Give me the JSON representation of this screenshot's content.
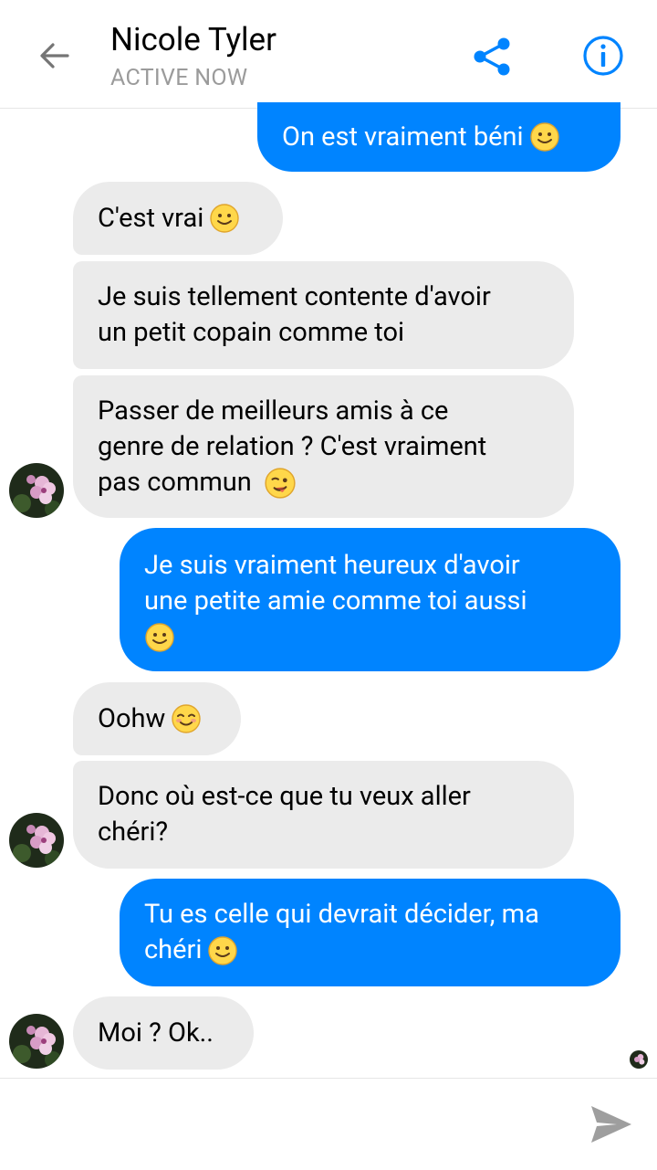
{
  "header": {
    "contact_name": "Nicole Tyler",
    "status": "ACTIVE NOW",
    "back_icon": "arrow-left-icon",
    "share_icon": "share-icon",
    "info_icon": "info-icon"
  },
  "messages": [
    {
      "dir": "out",
      "text": "On est vraiment béni",
      "emoji": "smile"
    },
    {
      "dir": "in",
      "text": "C'est vrai",
      "emoji": "smile"
    },
    {
      "dir": "in",
      "text_lines": [
        "Je suis tellement contente d'avoir",
        "un petit copain comme toi"
      ]
    },
    {
      "dir": "in",
      "text_lines": [
        "Passer de meilleurs amis à ce",
        "genre de relation ? C'est vraiment",
        "pas commun"
      ],
      "emoji": "wink"
    },
    {
      "dir": "out",
      "text_lines": [
        "Je suis vraiment heureux d'avoir",
        "une petite amie comme toi aussi"
      ],
      "emoji": "smile"
    },
    {
      "dir": "in",
      "text": "Oohw",
      "emoji": "blush"
    },
    {
      "dir": "in",
      "text_lines": [
        "Donc où est-ce que tu veux aller",
        "chéri?"
      ]
    },
    {
      "dir": "out",
      "text_lines": [
        "Tu es celle qui devrait décider, ma",
        "chéri"
      ],
      "emoji": "smile"
    },
    {
      "dir": "in",
      "text": "Moi ? Ok.."
    }
  ],
  "composer": {
    "placeholder": "",
    "send_icon": "send-icon"
  },
  "colors": {
    "accent": "#0084ff",
    "incoming_bubble": "#ebebeb",
    "status_text": "#9b9b9b"
  }
}
